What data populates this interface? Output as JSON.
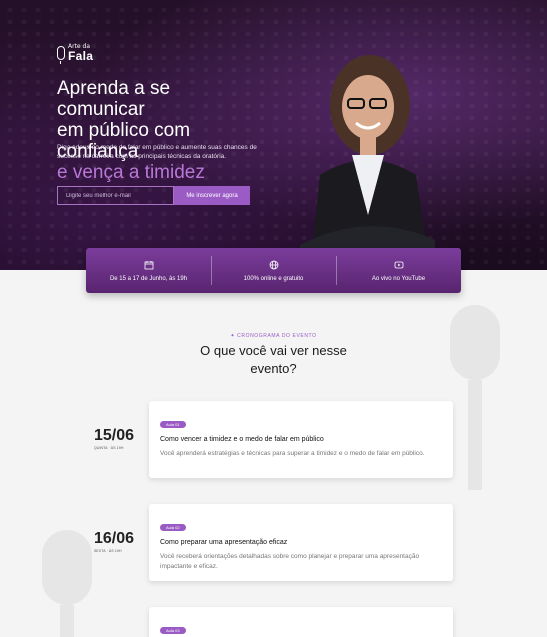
{
  "hero": {
    "logo_top": "Arte da",
    "logo_bottom": "Fala",
    "headline_line1": "Aprenda a se comunicar",
    "headline_line2": "em público com confiança",
    "headline_accent": "e vença a timidez",
    "subtext": "Diga adeus ao medo de falar em público e aumente suas chances de sucesso na carreira com as principais técnicas da oratória.",
    "email_placeholder": "Digite seu melhor e-mail",
    "cta_label": "Me inscrever agora"
  },
  "infobar": [
    {
      "icon": "calendar-icon",
      "label": "De 15 a 17 de Junho, às 19h"
    },
    {
      "icon": "globe-icon",
      "label": "100% online e gratuito"
    },
    {
      "icon": "youtube-icon",
      "label": "Ao vivo no YouTube"
    }
  ],
  "schedule": {
    "eyebrow": "✦ CRONOGRAMA DO EVENTO",
    "title": "O que você vai ver nesse evento?",
    "items": [
      {
        "date": "15/06",
        "meta": "QUINTA · ÀS 19H",
        "badge": "Aula 01",
        "title": "Como vencer a timidez e o medo de falar em público",
        "desc": "Você aprenderá estratégias e técnicas para superar a timidez e o medo de falar em público."
      },
      {
        "date": "16/06",
        "meta": "SEXTA · ÀS 19H",
        "badge": "Aula 02",
        "title": "Como preparar uma apresentação eficaz",
        "desc": "Você receberá orientações detalhadas sobre como planejar e preparar uma apresentação impactante e eficaz."
      },
      {
        "date": "",
        "meta": "",
        "badge": "Aula 03",
        "title": "",
        "desc": ""
      }
    ]
  },
  "colors": {
    "accent": "#9a5cc4",
    "hero_bg": "#241028",
    "bar": "#6a2f88"
  }
}
